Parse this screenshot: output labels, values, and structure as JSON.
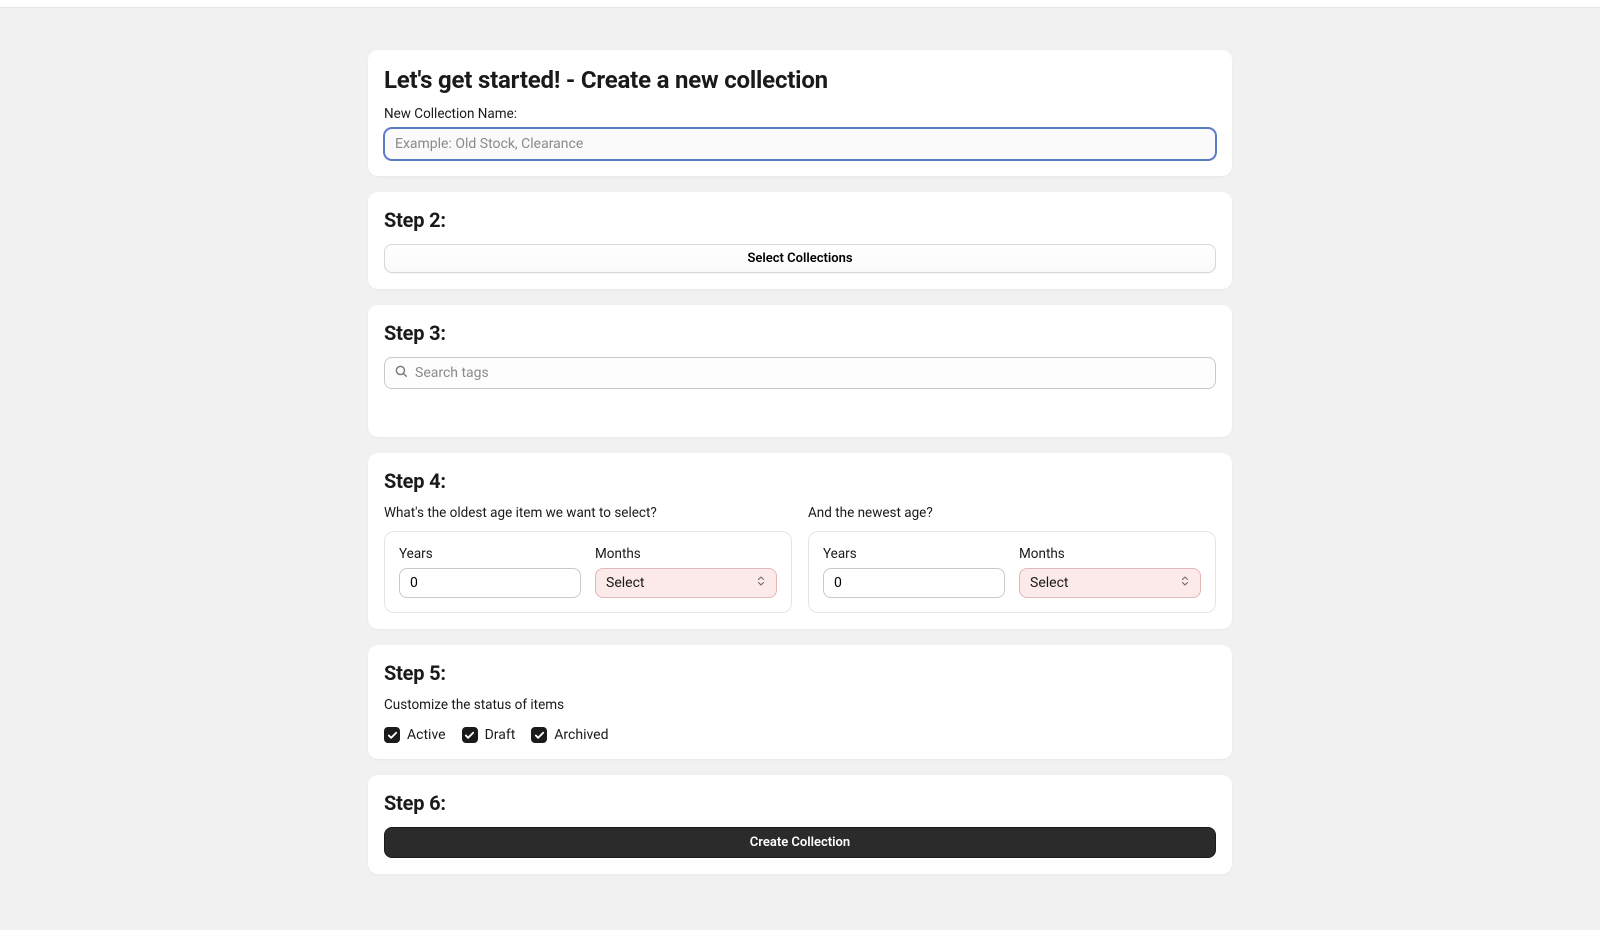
{
  "step1": {
    "title": "Let's get started! - Create a new collection",
    "name_label": "New Collection Name:",
    "name_placeholder": "Example: Old Stock, Clearance",
    "name_value": ""
  },
  "step2": {
    "title": "Step 2:",
    "button_label": "Select Collections"
  },
  "step3": {
    "title": "Step 3:",
    "search_placeholder": "Search tags"
  },
  "step4": {
    "title": "Step 4:",
    "oldest_label": "What's the oldest age item we want to select?",
    "newest_label": "And the newest age?",
    "years_label": "Years",
    "months_label": "Months",
    "oldest_years_value": "0",
    "newest_years_value": "0",
    "select_placeholder": "Select"
  },
  "step5": {
    "title": "Step 5:",
    "subtext": "Customize the status of items",
    "statuses": {
      "active": "Active",
      "draft": "Draft",
      "archived": "Archived"
    }
  },
  "step6": {
    "title": "Step 6:",
    "button_label": "Create Collection"
  }
}
